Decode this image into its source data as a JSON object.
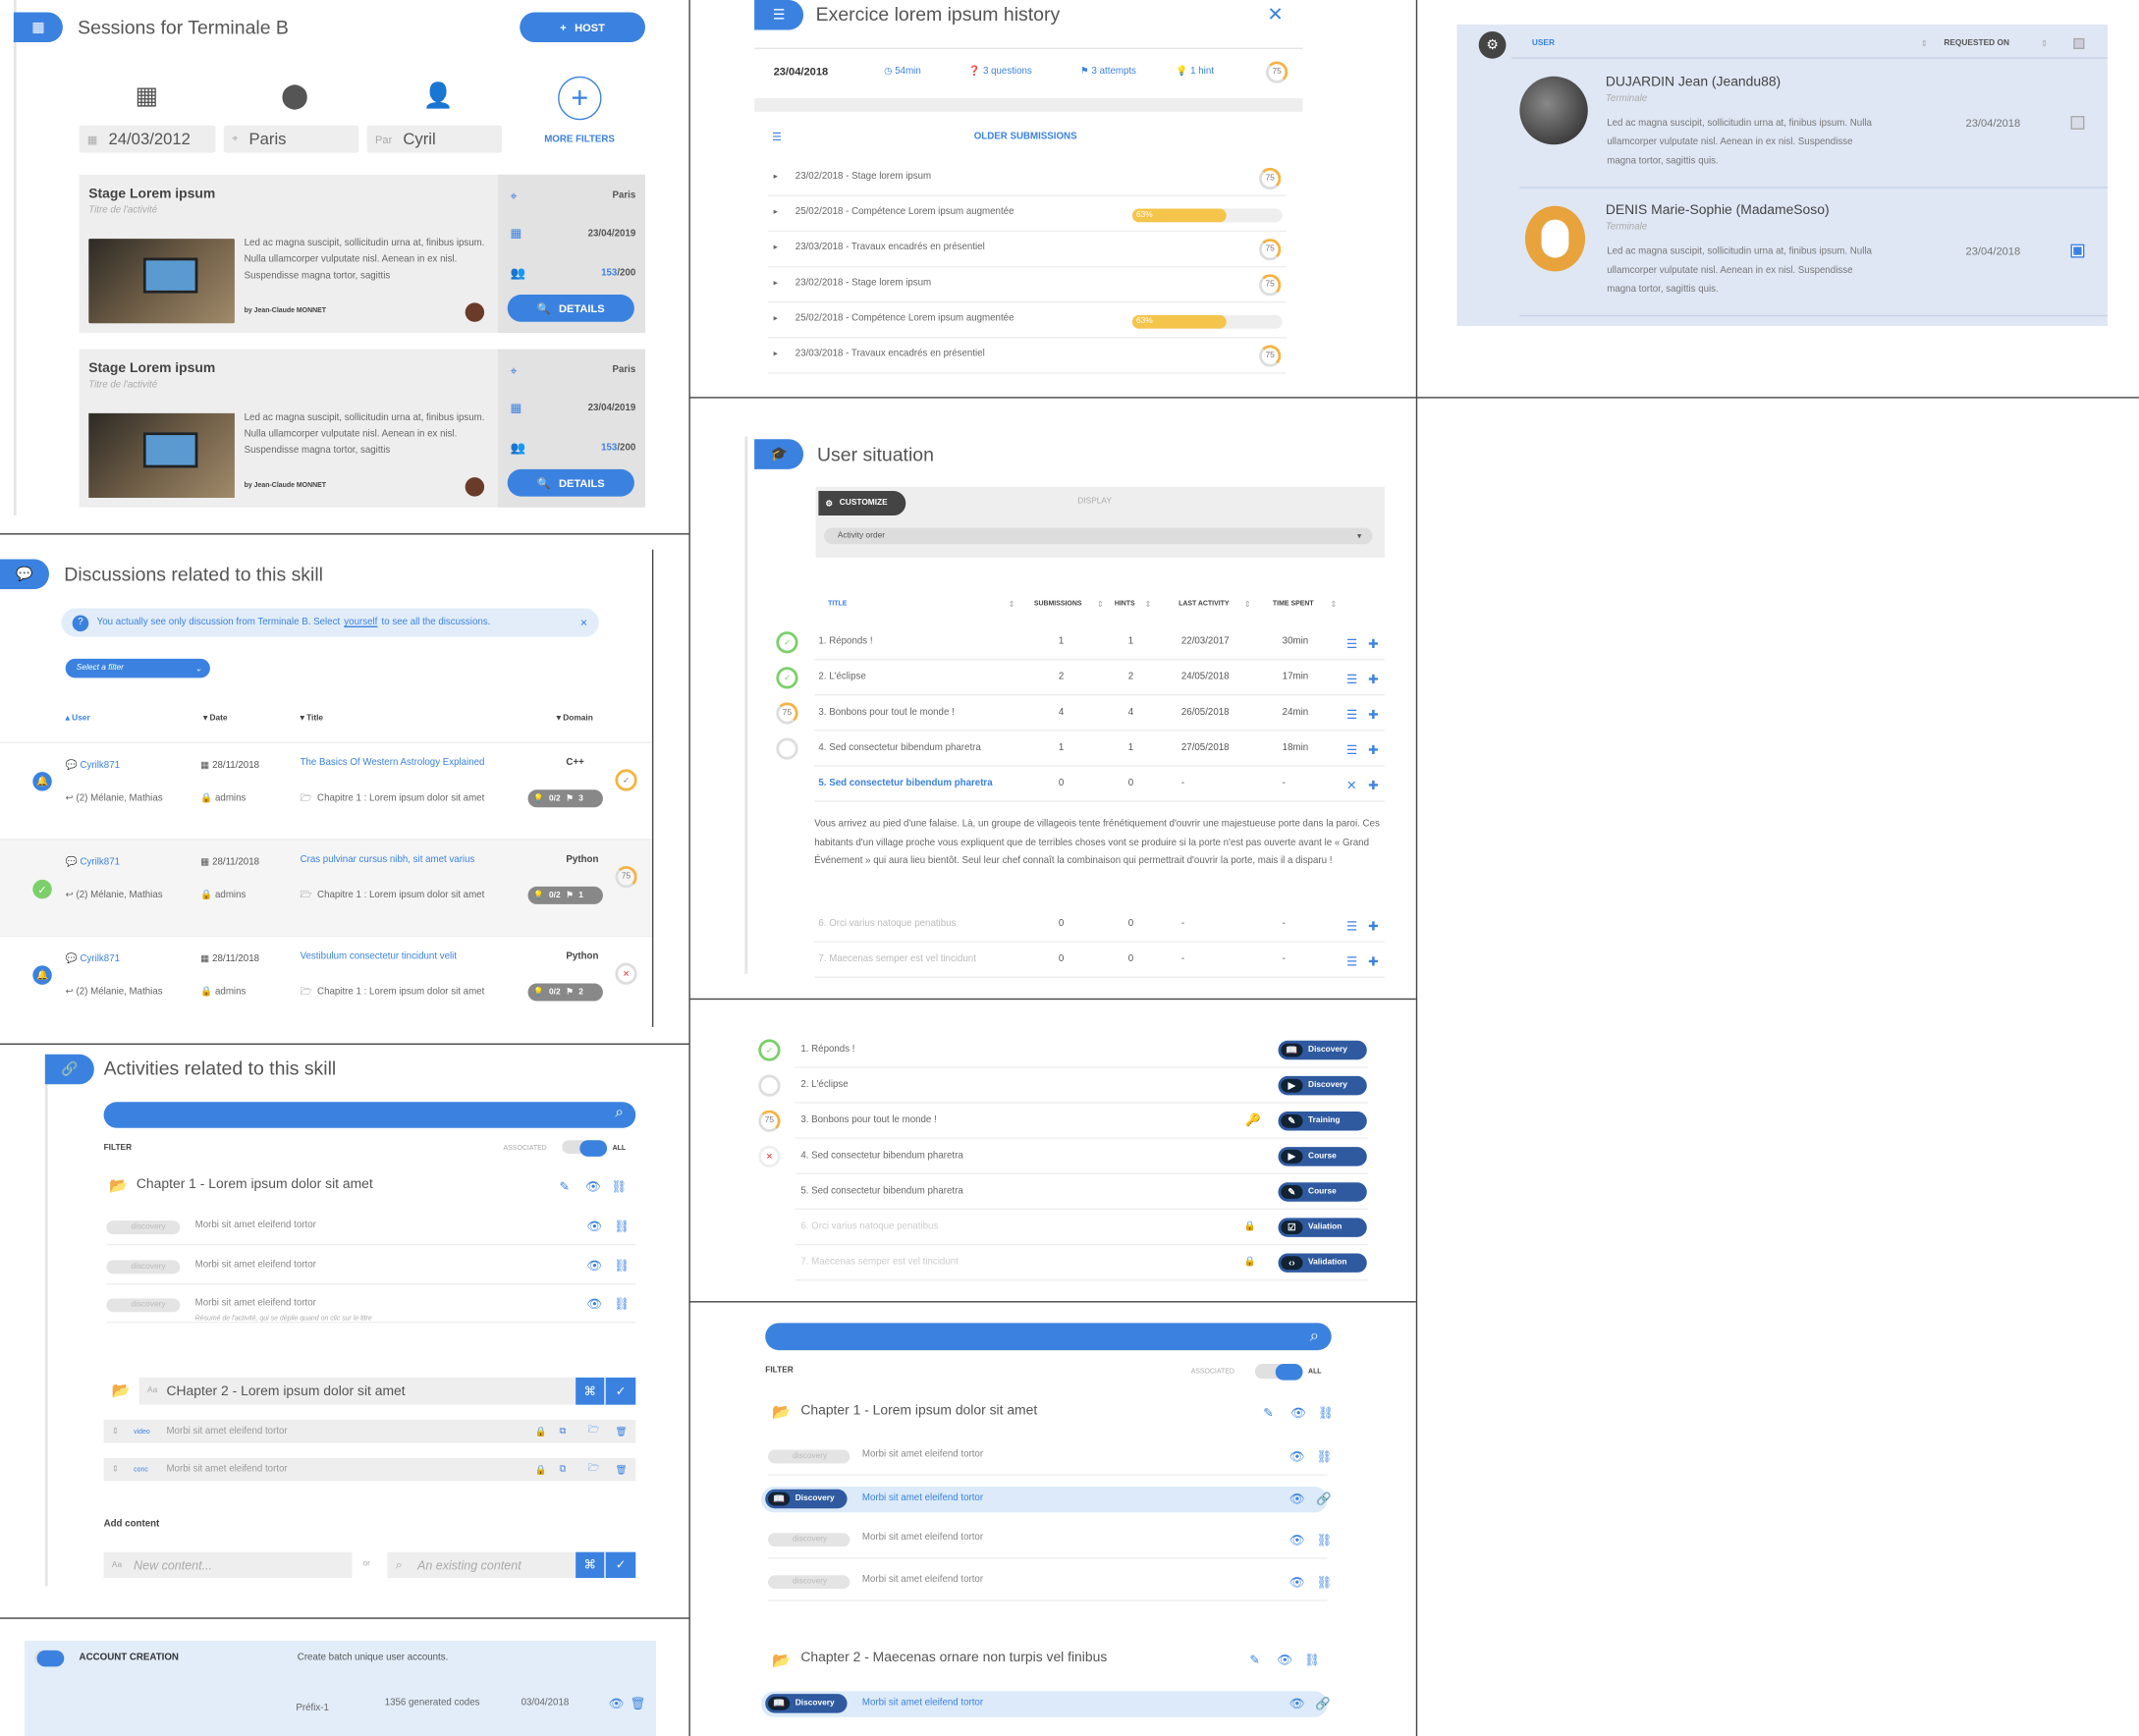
{
  "sessions": {
    "title": "Sessions for Terminale B",
    "host": "HOST",
    "date": "24/03/2012",
    "city": "Paris",
    "par": "Par",
    "person": "Cyril",
    "more": "MORE FILTERS",
    "cards": [
      {
        "title": "Stage Lorem ipsum",
        "subtitle": "Titre de l'activité",
        "text": "Led ac magna suscipit, sollicitudin urna at, finibus ipsum. Nulla ullamcorper vulputate nisl. Aenean in ex nisl. Suspendisse magna tortor, sagittis",
        "by": "by Jean-Claude MONNET",
        "city": "Paris",
        "date": "23/04/2019",
        "count": "153",
        "total": "/200",
        "details": "DETAILS"
      },
      {
        "title": "Stage Lorem ipsum",
        "subtitle": "Titre de l'activité",
        "text": "Led ac magna suscipit, sollicitudin urna at, finibus ipsum. Nulla ullamcorper vulputate nisl. Aenean in ex nisl. Suspendisse magna tortor, sagittis",
        "by": "by Jean-Claude MONNET",
        "city": "Paris",
        "date": "23/04/2019",
        "count": "153",
        "total": "/200",
        "details": "DETAILS"
      }
    ]
  },
  "history": {
    "title": "Exercice lorem ipsum history",
    "date": "23/04/2018",
    "time": "54min",
    "questions": "3 questions",
    "attempts": "3 attempts",
    "hint": "1 hint",
    "score": "75",
    "older": "OLDER SUBMISSIONS",
    "rows": [
      {
        "t": "23/02/2018 - Stage lorem ipsum",
        "s": "75"
      },
      {
        "t": "25/02/2018 - Compétence Lorem ipsum augmentée",
        "p": "63%"
      },
      {
        "t": "23/03/2018 - Travaux encadrés en présentiel",
        "s": "75"
      },
      {
        "t": "23/02/2018 - Stage lorem ipsum",
        "s": "75"
      },
      {
        "t": "25/02/2018 - Compétence Lorem ipsum augmentée",
        "p": "63%"
      },
      {
        "t": "23/03/2018 - Travaux encadrés en présentiel",
        "s": "75"
      }
    ]
  },
  "requests": {
    "col_user": "USER",
    "col_req": "REQUESTED ON",
    "rows": [
      {
        "name": "DUJARDIN Jean (Jeandu88)",
        "cls": "Terminale",
        "text": "Led ac magna suscipit, sollicitudin urna at, finibus ipsum. Nulla ullamcorper vulputate nisl. Aenean in ex nisl. Suspendisse magna tortor, sagittis quis.",
        "date": "23/04/2018"
      },
      {
        "name": "DENIS Marie-Sophie (MadameSoso)",
        "cls": "Terminale",
        "text": "Led ac magna suscipit, sollicitudin urna at, finibus ipsum. Nulla ullamcorper vulputate nisl. Aenean in ex nisl. Suspendisse magna tortor, sagittis quis.",
        "date": "23/04/2018"
      }
    ]
  },
  "discussions": {
    "title": "Discussions related to this skill",
    "info": "You actually see only discussion from Terminale B. Select",
    "info_link": "yourself",
    "info_end": "to see all the discussions.",
    "filter": "Select a filter",
    "cols": [
      "User",
      "Date",
      "Title",
      "Domain"
    ],
    "rows": [
      {
        "user": "Cyrilk871",
        "date": "28/11/2018",
        "title": "The Basics Of Western Astrology Explained",
        "domain": "C++",
        "people": "(2) Mélanie, Mathias",
        "group": "admins",
        "chapter": "Chapitre 1 : Lorem ipsum dolor sit amet",
        "c1": "0/2",
        "c2": "3"
      },
      {
        "user": "Cyrilk871",
        "date": "28/11/2018",
        "title": "Cras pulvinar cursus nibh, sit amet varius",
        "domain": "Python",
        "people": "(2) Mélanie, Mathias",
        "group": "admins",
        "chapter": "Chapitre 1 : Lorem ipsum dolor sit amet",
        "c1": "0/2",
        "c2": "1",
        "score": "75"
      },
      {
        "user": "Cyrilk871",
        "date": "28/11/2018",
        "title": "Vestibulum consectetur tincidunt velit",
        "domain": "Python",
        "people": "(2) Mélanie, Mathias",
        "group": "admins",
        "chapter": "Chapitre 1 : Lorem ipsum dolor sit amet",
        "c1": "0/2",
        "c2": "2"
      }
    ]
  },
  "situation": {
    "title": "User situation",
    "customize": "CUSTOMIZE",
    "display": "DISPLAY",
    "order": "Activity order",
    "cols": [
      "TITLE",
      "SUBMISSIONS",
      "HINTS",
      "LAST ACTIVITY",
      "TIME SPENT"
    ],
    "rows": [
      {
        "t": "1. Réponds !",
        "s": "1",
        "h": "1",
        "d": "22/03/2017",
        "tm": "30min"
      },
      {
        "t": "2. L'éclipse",
        "s": "2",
        "h": "2",
        "d": "24/05/2018",
        "tm": "17min"
      },
      {
        "t": "3. Bonbons pour tout le monde !",
        "s": "4",
        "h": "4",
        "d": "26/05/2018",
        "tm": "24min",
        "sc": "75"
      },
      {
        "t": "4. Sed consectetur bibendum pharetra",
        "s": "1",
        "h": "1",
        "d": "27/05/2018",
        "tm": "18min"
      },
      {
        "t": "5. Sed consectetur bibendum pharetra",
        "s": "0",
        "h": "0",
        "d": "-",
        "tm": "-"
      }
    ],
    "para": "Vous arrivez au pied d'une falaise. Là, un groupe de villageois tente frénétiquement d'ouvrir une majestueuse porte dans la paroi. Ces habitants d'un village proche vous expliquent que de terribles choses vont se produire si la porte n'est pas ouverte avant le « Grand Événement » qui aura lieu bientôt. Seul leur chef connaît la combinaison qui permettrait d'ouvrir la porte, mais il a disparu !",
    "rows2": [
      {
        "t": "6. Orci varius natoque penatibus",
        "s": "0",
        "h": "0",
        "d": "-",
        "tm": "-"
      },
      {
        "t": "7. Maecenas semper est vel tincidunt",
        "s": "0",
        "h": "0",
        "d": "-",
        "tm": "-"
      }
    ]
  },
  "activities": {
    "title": "Activities related to this skill",
    "filter": "FILTER",
    "assoc": "ASSOCIATED",
    "all": "ALL",
    "ch1": "Chapter 1 - Lorem ipsum dolor sit amet",
    "item": "Morbi sit amet eleifend tortor",
    "discovery": "discovery",
    "desc": "Résumé de l'activité, qui se déplie quand on clic sur le titre",
    "ch2": "CHapter 2 - Lorem ipsum dolor sit amet",
    "video": "video",
    "conc": "conc",
    "add": "Add content",
    "new_ph": "New content...",
    "or": "or",
    "exist_ph": "An existing content"
  },
  "list": {
    "rows": [
      {
        "t": "1. Réponds !",
        "tag": "Discovery"
      },
      {
        "t": "2. L'éclipse",
        "tag": "Discovery"
      },
      {
        "t": "3. Bonbons pour tout le monde !",
        "tag": "Training",
        "sc": "75"
      },
      {
        "t": "4. Sed consectetur bibendum pharetra",
        "tag": "Course"
      },
      {
        "t": "5. Sed consectetur bibendum pharetra",
        "tag": "Course"
      },
      {
        "t": "6. Orci varius natoque penatibus",
        "tag": "Valiation"
      },
      {
        "t": "7. Maecenas semper est vel tincidunt",
        "tag": "Validation"
      }
    ]
  },
  "chapters": {
    "filter": "FILTER",
    "assoc": "ASSOCIATED",
    "all": "ALL",
    "ch1": "Chapter 1 - Lorem ipsum dolor sit amet",
    "ch2": "Chapter 2 - Maecenas ornare non turpis vel finibus",
    "item": "Morbi sit amet eleifend tortor",
    "discovery": "discovery",
    "Discovery": "Discovery"
  },
  "account": {
    "title": "ACCOUNT CREATION",
    "desc": "Create batch unique user accounts.",
    "prefix": "Préfix-1",
    "codes": "1356 generated codes",
    "date": "03/04/2018"
  }
}
